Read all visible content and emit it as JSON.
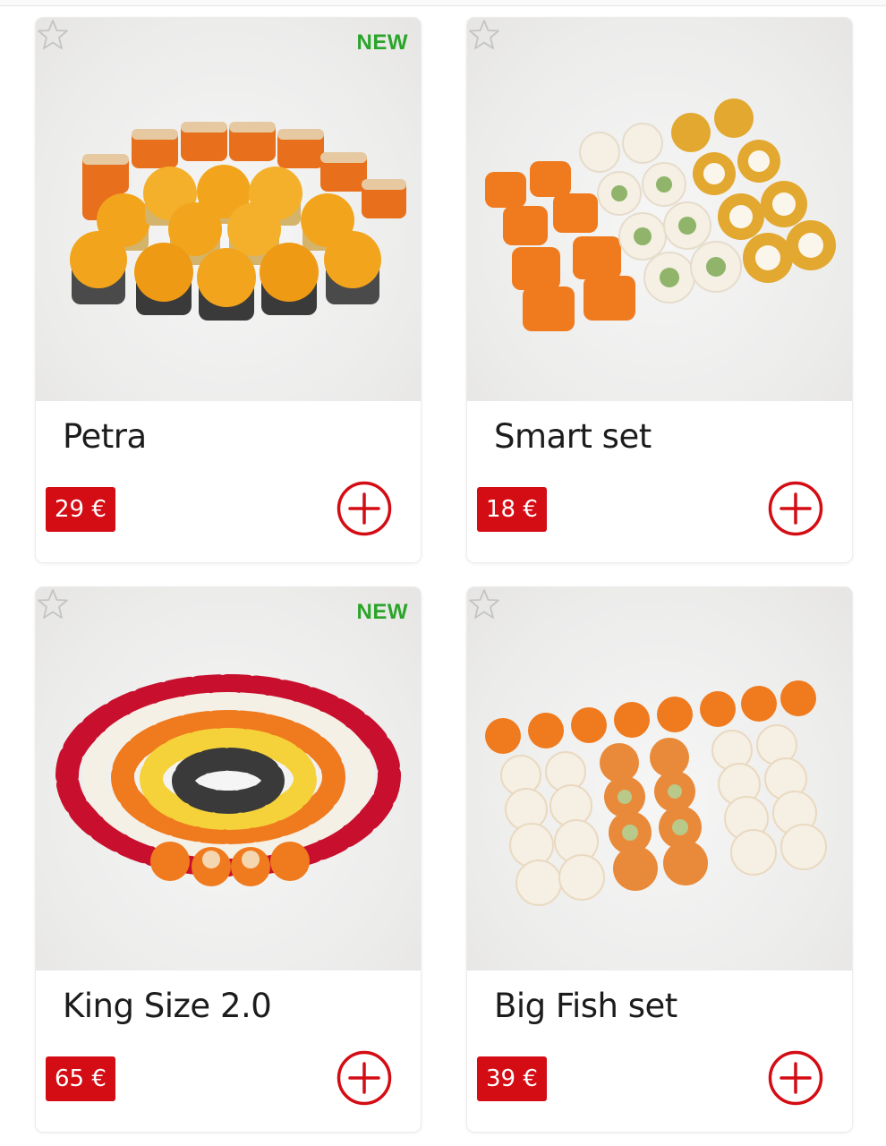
{
  "products": [
    {
      "name": "Petra",
      "price": "29 €",
      "badge": "NEW",
      "photo_palette": [
        "#e8701c",
        "#f2a51c",
        "#3a3a3a",
        "#d8c9a8"
      ],
      "favorite_icon": "star-outline-icon",
      "add_icon": "plus-circle-icon"
    },
    {
      "name": "Smart set",
      "price": "18 €",
      "badge": "",
      "photo_palette": [
        "#f07a1e",
        "#f5f0e6",
        "#e2a830",
        "#8fb46a"
      ],
      "favorite_icon": "star-outline-icon",
      "add_icon": "plus-circle-icon"
    },
    {
      "name": "King Size 2.0",
      "price": "65 €",
      "badge": "NEW",
      "photo_palette": [
        "#c8102e",
        "#f07a1e",
        "#f5d23a",
        "#f5f0e6"
      ],
      "favorite_icon": "star-outline-icon",
      "add_icon": "plus-circle-icon"
    },
    {
      "name": "Big Fish set",
      "price": "39 €",
      "badge": "",
      "photo_palette": [
        "#f07a1e",
        "#f5f0e6",
        "#e98a3a",
        "#b8c98a"
      ],
      "favorite_icon": "star-outline-icon",
      "add_icon": "plus-circle-icon"
    }
  ],
  "colors": {
    "accent": "#d40c14",
    "badge_new": "#2aa52a",
    "text": "#1c1c1c"
  }
}
